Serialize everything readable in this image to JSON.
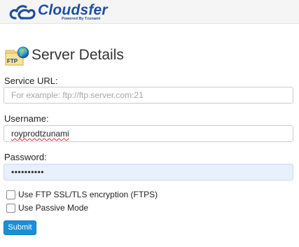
{
  "header": {
    "logo_name": "Cloudsfer",
    "logo_tagline": "Powered By Tzunami",
    "brand_color": "#1f4fa0"
  },
  "page": {
    "icon_label": "FTP",
    "title": "Server Details"
  },
  "form": {
    "service_url": {
      "label": "Service URL:",
      "placeholder": "For example: ftp://ftp.server.com:21",
      "value": ""
    },
    "username": {
      "label": "Username:",
      "value": "royprodtzunami"
    },
    "password": {
      "label": "Password:",
      "masked_value": "••••••••••"
    },
    "options": [
      {
        "label": "Use FTP SSL/TLS encryption (FTPS)",
        "checked": false
      },
      {
        "label": "Use Passive Mode",
        "checked": false
      }
    ],
    "submit_label": "Submit",
    "submit_color": "#1a8fd6"
  }
}
